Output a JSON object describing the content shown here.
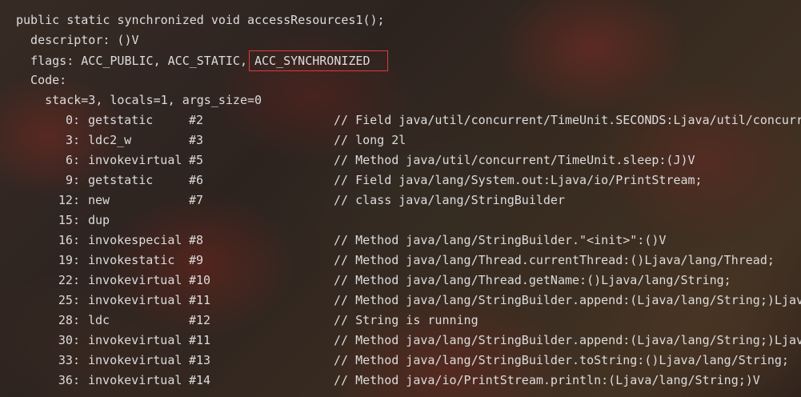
{
  "header": {
    "signature": "public static synchronized void accessResources1();",
    "descriptor": "  descriptor: ()V",
    "flags_prefix": "  flags: ACC_PUBLIC, ACC_STATIC,",
    "flags_highlight": "ACC_SYNCHRONIZED",
    "code_label": "  Code:",
    "stack_info": "    stack=3, locals=1, args_size=0"
  },
  "instructions": [
    {
      "offset": "0:",
      "op": "getstatic",
      "arg": "#2",
      "comment": "// Field java/util/concurrent/TimeUnit.SECONDS:Ljava/util/concurr"
    },
    {
      "offset": "3:",
      "op": "ldc2_w",
      "arg": "#3",
      "comment": "// long 2l"
    },
    {
      "offset": "6:",
      "op": "invokevirtual",
      "arg": "#5",
      "comment": "// Method java/util/concurrent/TimeUnit.sleep:(J)V"
    },
    {
      "offset": "9:",
      "op": "getstatic",
      "arg": "#6",
      "comment": "// Field java/lang/System.out:Ljava/io/PrintStream;"
    },
    {
      "offset": "12:",
      "op": "new",
      "arg": "#7",
      "comment": "// class java/lang/StringBuilder"
    },
    {
      "offset": "15:",
      "op": "dup",
      "arg": "",
      "comment": ""
    },
    {
      "offset": "16:",
      "op": "invokespecial",
      "arg": "#8",
      "comment": "// Method java/lang/StringBuilder.\"<init>\":()V"
    },
    {
      "offset": "19:",
      "op": "invokestatic",
      "arg": "#9",
      "comment": "// Method java/lang/Thread.currentThread:()Ljava/lang/Thread;"
    },
    {
      "offset": "22:",
      "op": "invokevirtual",
      "arg": "#10",
      "comment": "// Method java/lang/Thread.getName:()Ljava/lang/String;"
    },
    {
      "offset": "25:",
      "op": "invokevirtual",
      "arg": "#11",
      "comment": "// Method java/lang/StringBuilder.append:(Ljava/lang/String;)Ljav"
    },
    {
      "offset": "28:",
      "op": "ldc",
      "arg": "#12",
      "comment": "// String is running"
    },
    {
      "offset": "30:",
      "op": "invokevirtual",
      "arg": "#11",
      "comment": "// Method java/lang/StringBuilder.append:(Ljava/lang/String;)Ljav"
    },
    {
      "offset": "33:",
      "op": "invokevirtual",
      "arg": "#13",
      "comment": "// Method java/lang/StringBuilder.toString:()Ljava/lang/String;"
    },
    {
      "offset": "36:",
      "op": "invokevirtual",
      "arg": "#14",
      "comment": "// Method java/io/PrintStream.println:(Ljava/lang/String;)V"
    }
  ],
  "colors": {
    "text": "#dcdcdc",
    "highlight_border": "#e0393e"
  }
}
